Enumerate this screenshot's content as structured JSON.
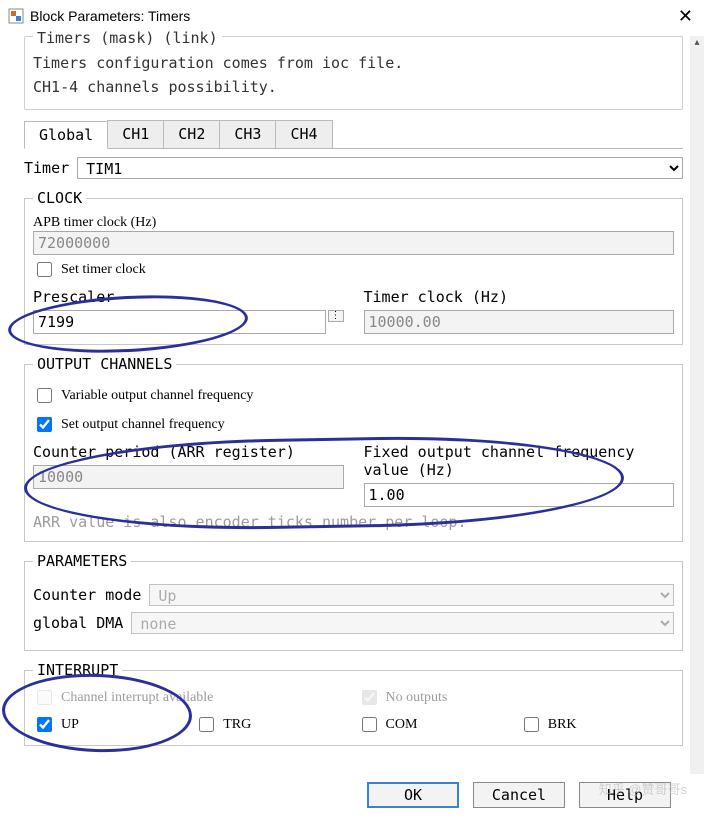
{
  "window": {
    "title": "Block Parameters: Timers"
  },
  "mask": {
    "head": "Timers (mask) (link)",
    "line1": "Timers configuration comes from ioc file.",
    "line2": "CH1-4 channels possibility."
  },
  "tabs": [
    "Global",
    "CH1",
    "CH2",
    "CH3",
    "CH4"
  ],
  "timer": {
    "label": "Timer",
    "value": "TIM1"
  },
  "clock": {
    "legend": "CLOCK",
    "apb_label": "APB timer clock (Hz)",
    "apb_value": "72000000",
    "set_timer_clock_label": "Set timer clock",
    "set_timer_clock_checked": false,
    "prescaler_label": "Prescaler",
    "prescaler_value": "7199",
    "timer_clock_label": "Timer clock (Hz)",
    "timer_clock_value": "10000.00"
  },
  "output": {
    "legend": "OUTPUT CHANNELS",
    "variable_label": "Variable output channel frequency",
    "variable_checked": false,
    "set_freq_label": "Set output channel frequency",
    "set_freq_checked": true,
    "counter_period_label": "Counter period (ARR register)",
    "counter_period_value": "10000",
    "fixed_freq_label": "Fixed output channel frequency value (Hz)",
    "fixed_freq_value": "1.00",
    "note": "ARR value is also encoder ticks number per loop."
  },
  "params": {
    "legend": "PARAMETERS",
    "counter_mode_label": "Counter mode",
    "counter_mode_value": "Up",
    "global_dma_label": "global DMA",
    "global_dma_value": "none"
  },
  "interrupt": {
    "legend": "INTERRUPT",
    "channel_label": "Channel interrupt available",
    "channel_checked": false,
    "no_outputs_label": "No outputs",
    "no_outputs_checked": true,
    "up_label": "UP",
    "up_checked": true,
    "trg_label": "TRG",
    "trg_checked": false,
    "com_label": "COM",
    "com_checked": false,
    "brk_label": "BRK",
    "brk_checked": false
  },
  "buttons": {
    "ok": "OK",
    "cancel": "Cancel",
    "help": "Help"
  },
  "watermark": "知乎 @赞哥哥s"
}
